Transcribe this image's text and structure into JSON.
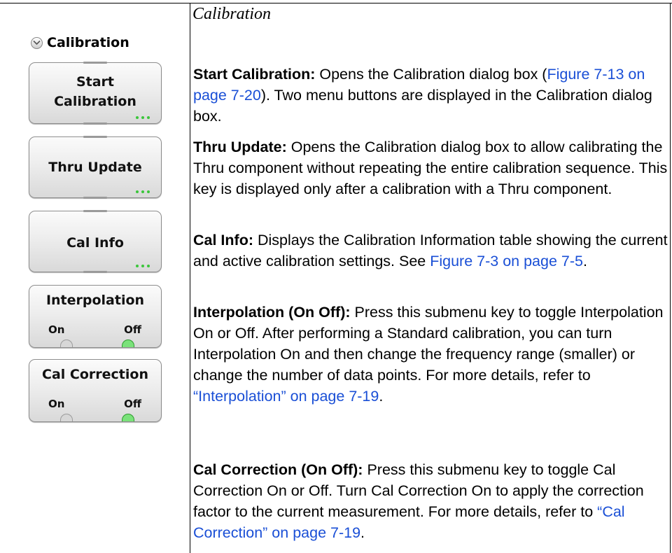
{
  "caption": "Calibration",
  "menu": {
    "header": "Calibration",
    "buttons": [
      {
        "line1": "Start",
        "line2": "Calibration"
      },
      {
        "label": "Thru Update"
      },
      {
        "label": "Cal Info"
      },
      {
        "label": "Interpolation",
        "on": "On",
        "off": "Off",
        "state": "Off"
      },
      {
        "label": "Cal Correction",
        "on": "On",
        "off": "Off",
        "state": "Off"
      }
    ]
  },
  "descriptions": [
    {
      "title": "Start Calibration:",
      "pre": "  Opens the Calibration dialog box (",
      "link": "Figure 7-13 on page 7-20",
      "post": "). Two menu buttons are displayed in the Calibration dialog box."
    },
    {
      "title": "Thru Update:",
      "pre": "  Opens the Calibration dialog box to allow calibrating the Thru component without repeating the entire calibration sequence. This key is displayed only after a calibration with a Thru component.",
      "link": "",
      "post": ""
    },
    {
      "title": "Cal Info:",
      "pre": "  Displays the Calibration Information table showing the current and active calibration settings. See ",
      "link": "Figure 7-3 on page 7-5",
      "post": "."
    },
    {
      "title": "Interpolation (On Off):",
      "pre": "  Press this submenu key to toggle Interpolation On or Off. After performing a Standard calibration, you can turn Interpolation On and then change the frequency range (smaller) or change the number of data points. For more details, refer to ",
      "link": "“Interpolation” on page 7-19",
      "post": "."
    },
    {
      "title": "Cal Correction (On Off):",
      "pre": "  Press this submenu key to toggle Cal Correction On or Off. Turn Cal Correction On to apply the correction factor to the current measurement. For more details, refer to ",
      "link": "“Cal Correction” on page 7-19",
      "post": "."
    }
  ],
  "colors": {
    "link": "#1a4fd6",
    "indicator_active": "#7ae27a",
    "dots": "#3ac63a"
  }
}
